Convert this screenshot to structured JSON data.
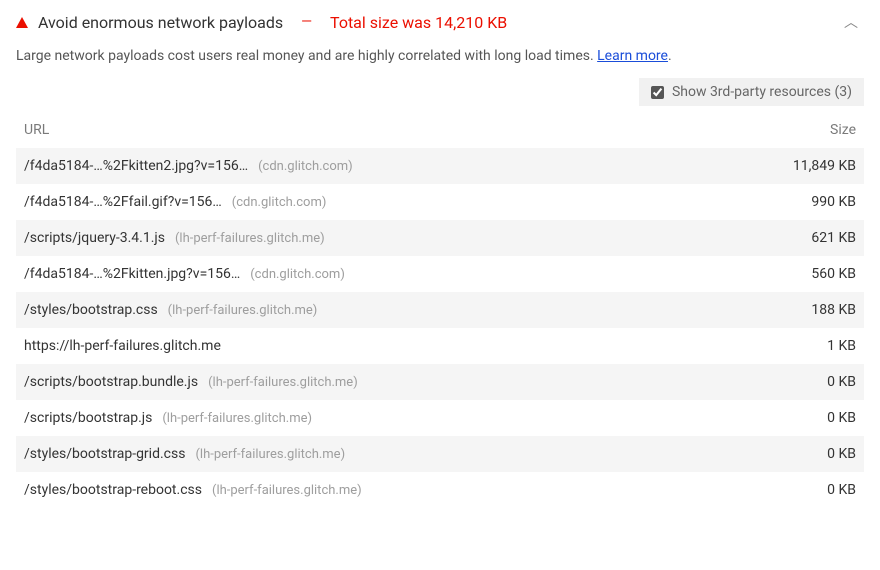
{
  "header": {
    "title": "Avoid enormous network payloads",
    "dash": "—",
    "summary": "Total size was 14,210 KB"
  },
  "description": {
    "text": "Large network payloads cost users real money and are highly correlated with long load times. ",
    "learn_more": "Learn more",
    "period": "."
  },
  "toggle": {
    "label": "Show 3rd-party resources (3)",
    "checked": true
  },
  "table": {
    "headers": {
      "url": "URL",
      "size": "Size"
    },
    "rows": [
      {
        "path": "/f4da5184-…%2Fkitten2.jpg?v=156…",
        "origin": "(cdn.glitch.com)",
        "size": "11,849 KB"
      },
      {
        "path": "/f4da5184-…%2Ffail.gif?v=156…",
        "origin": "(cdn.glitch.com)",
        "size": "990 KB"
      },
      {
        "path": "/scripts/jquery-3.4.1.js",
        "origin": "(lh-perf-failures.glitch.me)",
        "size": "621 KB"
      },
      {
        "path": "/f4da5184-…%2Fkitten.jpg?v=156…",
        "origin": "(cdn.glitch.com)",
        "size": "560 KB"
      },
      {
        "path": "/styles/bootstrap.css",
        "origin": "(lh-perf-failures.glitch.me)",
        "size": "188 KB"
      },
      {
        "path": "https://lh-perf-failures.glitch.me",
        "origin": "",
        "size": "1 KB"
      },
      {
        "path": "/scripts/bootstrap.bundle.js",
        "origin": "(lh-perf-failures.glitch.me)",
        "size": "0 KB"
      },
      {
        "path": "/scripts/bootstrap.js",
        "origin": "(lh-perf-failures.glitch.me)",
        "size": "0 KB"
      },
      {
        "path": "/styles/bootstrap-grid.css",
        "origin": "(lh-perf-failures.glitch.me)",
        "size": "0 KB"
      },
      {
        "path": "/styles/bootstrap-reboot.css",
        "origin": "(lh-perf-failures.glitch.me)",
        "size": "0 KB"
      }
    ]
  }
}
